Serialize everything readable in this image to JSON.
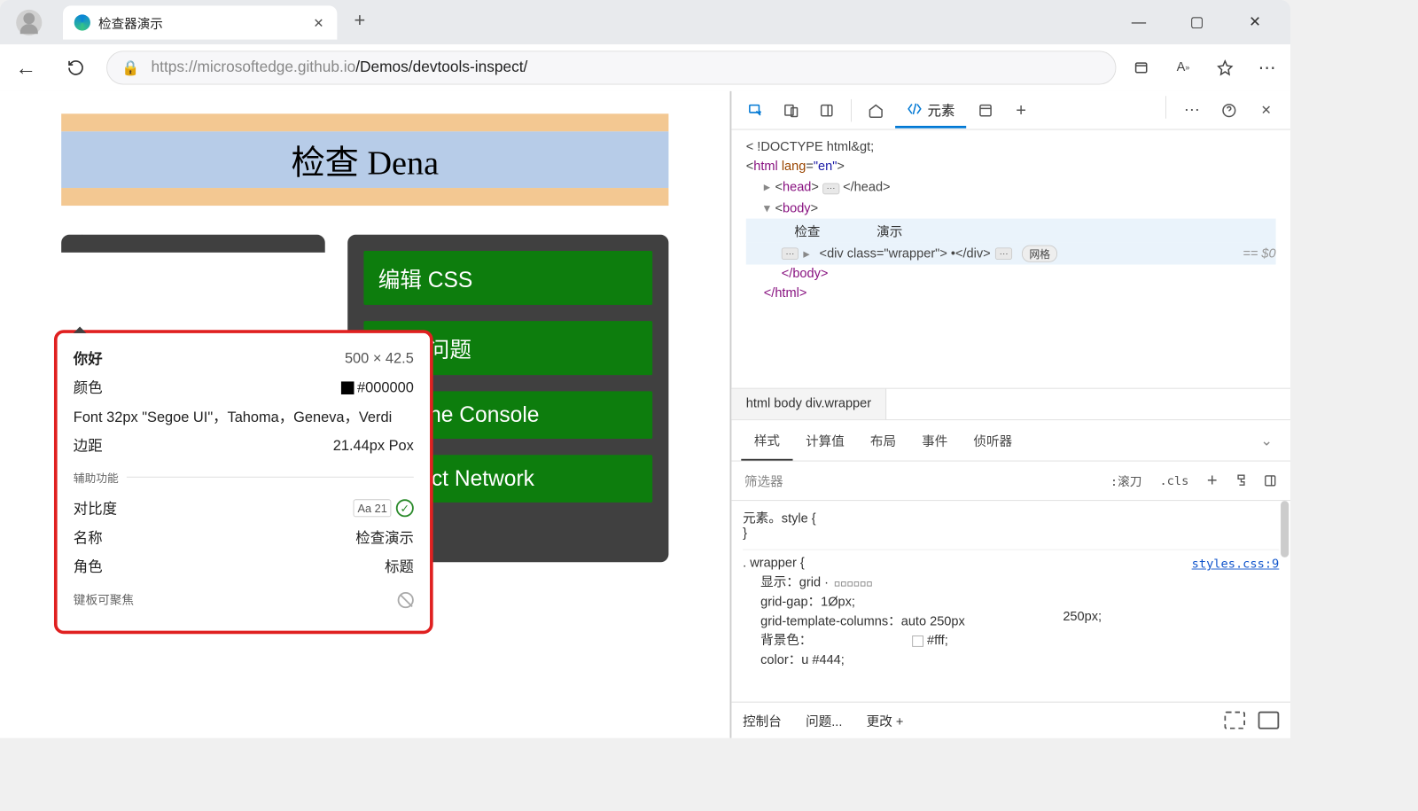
{
  "browser": {
    "tab_title": "检查器演示",
    "url_host": "https://microsoftedge.github.io",
    "url_path": "/Demos/devtools-inspect/"
  },
  "page": {
    "banner_text": "检查 Dena",
    "buttons": [
      "编辑 CSS",
      "查找 问题",
      "Use the Console",
      "Inspect Network"
    ]
  },
  "tooltip": {
    "title": "你好",
    "dimensions": "500 × 42.5",
    "color_label": "颜色",
    "color_value": "#000000",
    "font_label": "Font 32px \"Segoe UI\"，Tahoma，Geneva，Verdi",
    "margin_label": "边距",
    "margin_value": "21.44px Pox",
    "a11y_section": "辅助功能",
    "contrast_label": "对比度",
    "contrast_badge": "Aa 21",
    "name_label": "名称",
    "name_value": "检查演示",
    "role_label": "角色",
    "role_value": "标题",
    "keyboard_label": "键板可聚焦"
  },
  "devtools": {
    "active_tab": "元素",
    "dom": {
      "doctype": "< !DOCTYPE html&gt;",
      "html_open": "html",
      "html_attr_name": "lang",
      "html_attr_val": "en",
      "head": "head",
      "head_close": "</head>",
      "body": "body",
      "anno1": "检查",
      "anno2": "演示",
      "wrapper_open": "<div class=\"wrapper\"> •</div>",
      "wrapper_badge": "网格",
      "eq": "== $0",
      "body_close": "</body>",
      "html_close": "</html>"
    },
    "breadcrumb": "html body div.wrapper",
    "style_tabs": [
      "样式",
      "计算值",
      "布局",
      "事件",
      "侦听器"
    ],
    "filter_placeholder": "筛选器",
    "filter_btn1": ":滚刀",
    "filter_btn2": ".cls",
    "element_style": "元素。style {",
    "close_brace": "}",
    "wrapper_sel": ". wrapper {",
    "wrapper_link": "styles.css:9",
    "props": {
      "display": "显示：grid ·",
      "gap": "grid-gap：1Øpx;",
      "cols": "grid-template-columns：auto 250px",
      "cols_extra": "250px;",
      "bg": "背景色：",
      "bg_val": "#fff;",
      "color": "color：u #444;"
    },
    "drawer": [
      "控制台",
      "问题...",
      "更改 +"
    ]
  }
}
